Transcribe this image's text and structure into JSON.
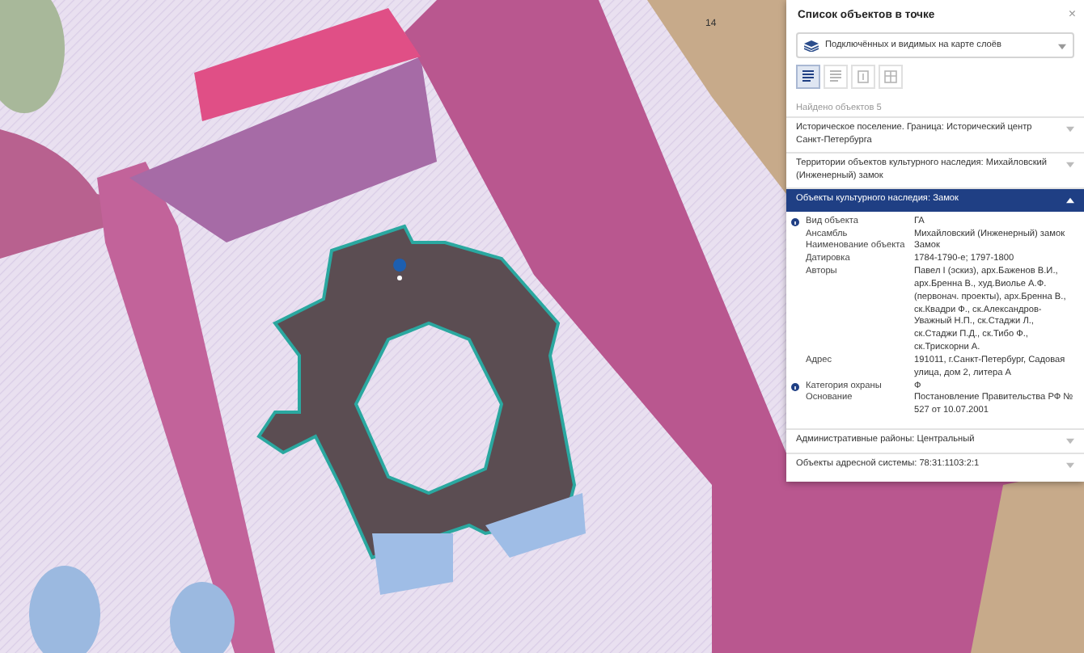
{
  "map": {
    "house_number": "14"
  },
  "panel": {
    "title": "Список объектов в точке",
    "close": "×",
    "layer_select": {
      "value": "Подключённых и видимых на карте слоёв"
    },
    "toolbar": [
      {
        "kind": "list",
        "selected": true
      },
      {
        "kind": "list",
        "selected": false
      },
      {
        "kind": "single",
        "selected": false
      },
      {
        "kind": "table",
        "selected": false
      }
    ],
    "found": "Найдено объектов 5",
    "groups": [
      {
        "title": "Историческое поселение. Граница: Исторический центр Санкт-Петербурга",
        "expanded": false
      },
      {
        "title": "Территории объектов культурного наследия: Михайловский (Инженерный) замок",
        "expanded": false
      },
      {
        "title": "Объекты культурного наследия: Замок",
        "expanded": true,
        "attributes": [
          {
            "name": "Вид объекта",
            "value": "ГА",
            "info": true
          },
          {
            "name": "Ансамбль",
            "value": "Михайловский (Инженерный) замок",
            "info": false
          },
          {
            "name": "Наименование объекта",
            "value": "Замок",
            "info": false
          },
          {
            "name": "Датировка",
            "value": "1784-1790-е; 1797-1800",
            "info": false
          },
          {
            "name": "Авторы",
            "value": "Павел I (эскиз), арх.Баженов В.И., арх.Бренна В., худ.Виолье А.Ф. (первонач. проекты), арх.Бренна В., ск.Квадри Ф., ск.Александров-Уважный Н.П., ск.Стаджи Л., ск.Стаджи П.Д., ск.Тибо Ф., ск.Трискорни А.",
            "info": false
          },
          {
            "name": "Адрес",
            "value": "191011, г.Санкт-Петербург, Садовая улица, дом 2, литера А",
            "info": false
          },
          {
            "name": "Категория охраны",
            "value": "Ф",
            "info": true
          },
          {
            "name": "Основание",
            "value": "Постановление Правительства РФ № 527 от 10.07.2001",
            "info": false
          }
        ]
      },
      {
        "title": "Административные районы: Центральный",
        "expanded": false
      },
      {
        "title": "Объекты адресной системы: 78:31:1103:2:1",
        "expanded": false
      }
    ]
  }
}
